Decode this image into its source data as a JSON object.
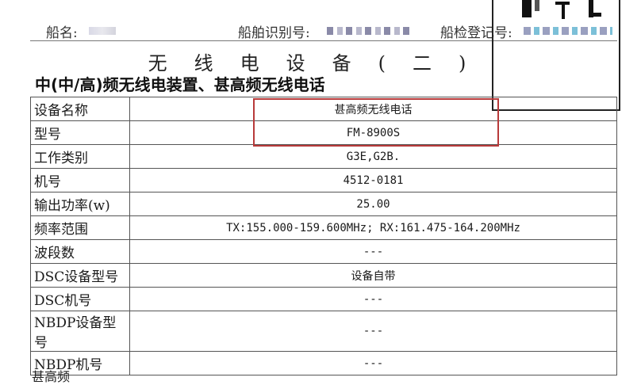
{
  "header": {
    "ship_name_label": "船名:",
    "ship_id_label": "船舶识别号:",
    "inspection_reg_label": "船检登记号:"
  },
  "title": "无线电设备(二)",
  "section_heading": "中(中/高)频无线电装置、甚高频无线电话",
  "rows": [
    {
      "label": "设备名称",
      "value": "甚高频无线电话"
    },
    {
      "label": "型号",
      "value": "FM-8900S"
    },
    {
      "label": "工作类别",
      "value": "G3E,G2B."
    },
    {
      "label": "机号",
      "value": "4512-0181"
    },
    {
      "label": "输出功率(w)",
      "value": "25.00"
    },
    {
      "label": "频率范围",
      "value": "TX:155.000-159.600MHz; RX:161.475-164.200MHz"
    },
    {
      "label": "波段数",
      "value": "---"
    },
    {
      "label": "DSC设备型号",
      "value": "设备自带"
    },
    {
      "label": "DSC机号",
      "value": "---"
    },
    {
      "label": "NBDP设备型号",
      "value": "---"
    },
    {
      "label": "NBDP机号",
      "value": "---"
    }
  ],
  "highlight_color": "#b83a3a",
  "footer_text": "甚高频"
}
